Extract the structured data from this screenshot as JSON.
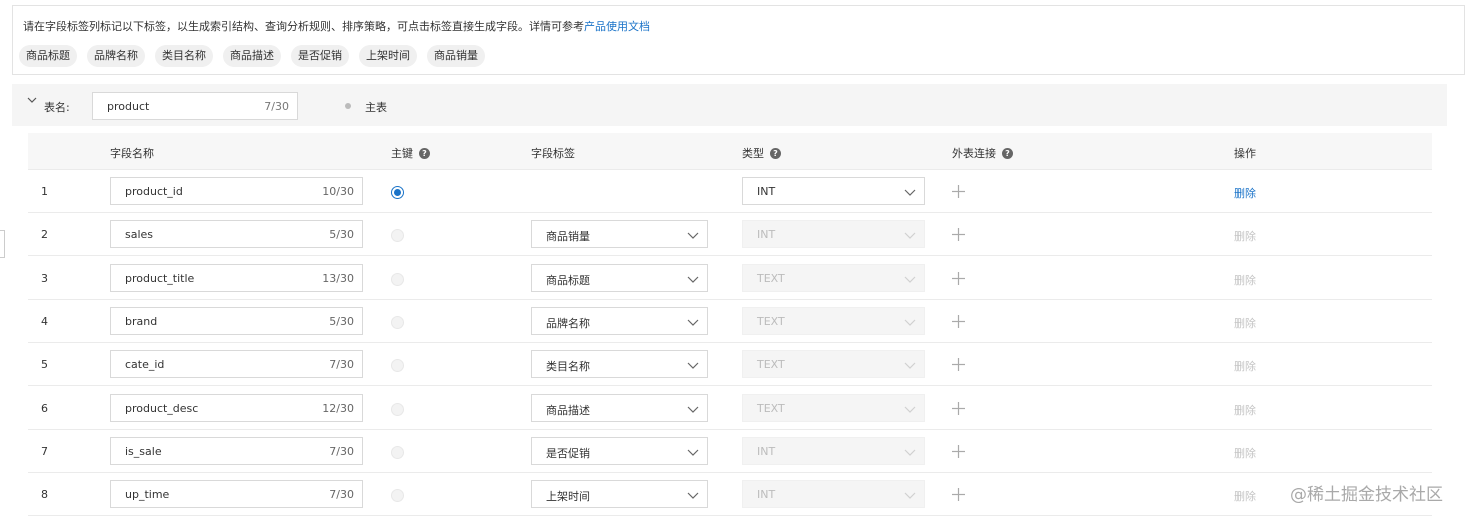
{
  "tag_panel": {
    "hint_text": "请在字段标签列标记以下标签，以生成索引结构、查询分析规则、排序策略，可点击标签直接生成字段。详情可参考",
    "doc_link": "产品使用文档",
    "tags": [
      "商品标题",
      "品牌名称",
      "类目名称",
      "商品描述",
      "是否促销",
      "上架时间",
      "商品销量"
    ]
  },
  "table_bar": {
    "label": "表名:",
    "name_value": "product",
    "name_count": "7/30",
    "main_label": "主表"
  },
  "header": {
    "field_name": "字段名称",
    "primary_key": "主键",
    "field_tag": "字段标签",
    "type": "类型",
    "foreign_join": "外表连接",
    "actions": "操作"
  },
  "rows": [
    {
      "index": "1",
      "field": "product_id",
      "count": "10/30",
      "primary": true,
      "tag": "",
      "type": "INT",
      "type_enabled": true,
      "delete": "删除",
      "delete_enabled": true
    },
    {
      "index": "2",
      "field": "sales",
      "count": "5/30",
      "primary": false,
      "tag": "商品销量",
      "type": "INT",
      "type_enabled": false,
      "delete": "删除",
      "delete_enabled": false
    },
    {
      "index": "3",
      "field": "product_title",
      "count": "13/30",
      "primary": false,
      "tag": "商品标题",
      "type": "TEXT",
      "type_enabled": false,
      "delete": "删除",
      "delete_enabled": false
    },
    {
      "index": "4",
      "field": "brand",
      "count": "5/30",
      "primary": false,
      "tag": "品牌名称",
      "type": "TEXT",
      "type_enabled": false,
      "delete": "删除",
      "delete_enabled": false
    },
    {
      "index": "5",
      "field": "cate_id",
      "count": "7/30",
      "primary": false,
      "tag": "类目名称",
      "type": "TEXT",
      "type_enabled": false,
      "delete": "删除",
      "delete_enabled": false
    },
    {
      "index": "6",
      "field": "product_desc",
      "count": "12/30",
      "primary": false,
      "tag": "商品描述",
      "type": "TEXT",
      "type_enabled": false,
      "delete": "删除",
      "delete_enabled": false
    },
    {
      "index": "7",
      "field": "is_sale",
      "count": "7/30",
      "primary": false,
      "tag": "是否促销",
      "type": "INT",
      "type_enabled": false,
      "delete": "删除",
      "delete_enabled": false
    },
    {
      "index": "8",
      "field": "up_time",
      "count": "7/30",
      "primary": false,
      "tag": "上架时间",
      "type": "INT",
      "type_enabled": false,
      "delete": "删除",
      "delete_enabled": false
    }
  ],
  "watermark": "@稀土掘金技术社区",
  "colors": {
    "link": "#1a73c8",
    "disabled_text": "#bcbcbc",
    "header_bg": "#f7f7f7"
  }
}
